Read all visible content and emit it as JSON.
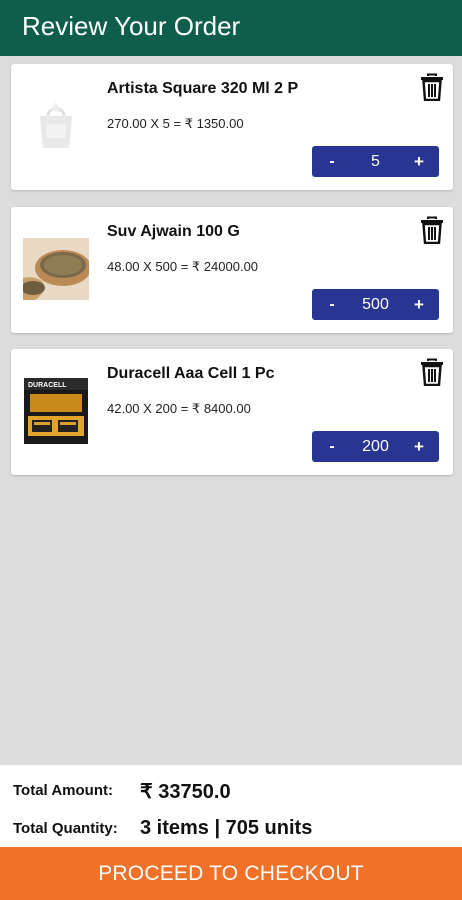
{
  "header": {
    "title": "Review Your Order"
  },
  "items": [
    {
      "name": "Artista Square 320 Ml 2 P",
      "price_line": "270.00 X 5 = ₹ 1350.00",
      "qty": "5",
      "minus": "-",
      "plus": "+",
      "image": "placeholder-bag-icon"
    },
    {
      "name": "Suv Ajwain 100 G",
      "price_line": "48.00 X 500 = ₹ 24000.00",
      "qty": "500",
      "minus": "-",
      "plus": "+",
      "image": "ajwain-product-image"
    },
    {
      "name": "Duracell Aaa Cell 1 Pc",
      "price_line": "42.00 X 200 = ₹ 8400.00",
      "qty": "200",
      "minus": "-",
      "plus": "+",
      "image": "duracell-product-image",
      "image_text": "DURACELL"
    }
  ],
  "summary": {
    "total_amount_label": "Total Amount:",
    "total_amount_value": "₹ 33750.0",
    "total_quantity_label": "Total Quantity:",
    "total_quantity_value": "3 items | 705 units"
  },
  "checkout": {
    "label": "PROCEED TO CHECKOUT"
  },
  "colors": {
    "header": "#0f5e4b",
    "stepper": "#283593",
    "checkout": "#f07127",
    "background": "#dcdcdc"
  }
}
